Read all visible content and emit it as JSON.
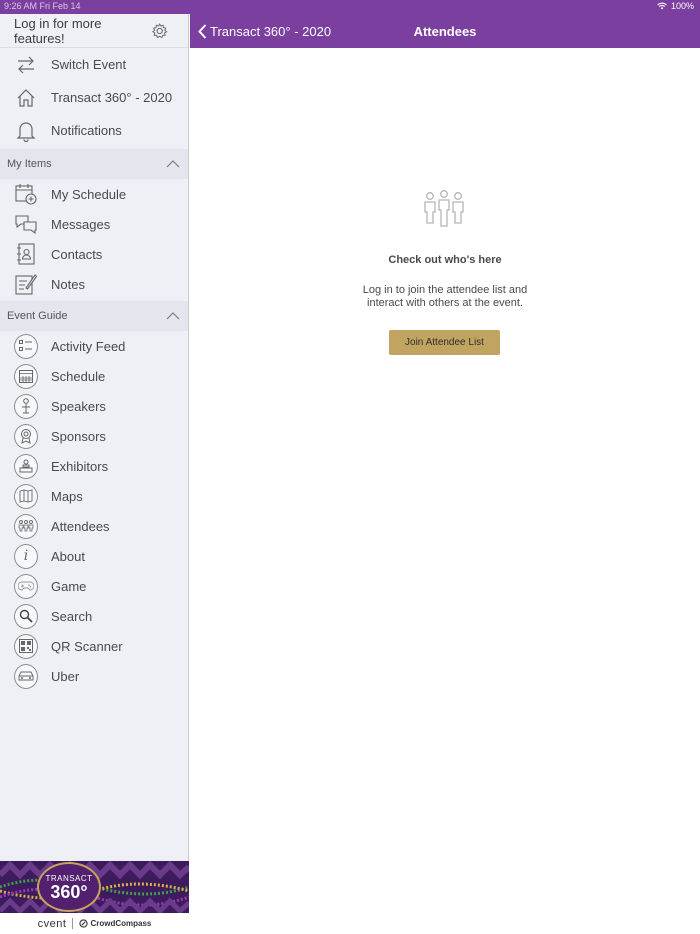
{
  "status_bar": {
    "time_date": "9:26 AM   Fri Feb 14",
    "battery": "100%"
  },
  "sidebar": {
    "login_prompt": "Log in for more features!",
    "top_items": [
      {
        "label": "Switch Event",
        "icon": "switch-arrows-icon"
      },
      {
        "label": "Transact 360° - 2020",
        "icon": "home-icon"
      },
      {
        "label": "Notifications",
        "icon": "bell-icon"
      }
    ],
    "my_items": {
      "header": "My Items",
      "items": [
        {
          "label": "My Schedule",
          "icon": "calendar-add-icon"
        },
        {
          "label": "Messages",
          "icon": "chat-bubbles-icon"
        },
        {
          "label": "Contacts",
          "icon": "contact-book-icon"
        },
        {
          "label": "Notes",
          "icon": "note-pencil-icon"
        }
      ]
    },
    "event_guide": {
      "header": "Event Guide",
      "items": [
        {
          "label": "Activity Feed",
          "icon": "activity-feed-icon"
        },
        {
          "label": "Schedule",
          "icon": "calendar-icon"
        },
        {
          "label": "Speakers",
          "icon": "speaker-icon"
        },
        {
          "label": "Sponsors",
          "icon": "ribbon-icon"
        },
        {
          "label": "Exhibitors",
          "icon": "exhibitor-icon"
        },
        {
          "label": "Maps",
          "icon": "map-icon"
        },
        {
          "label": "Attendees",
          "icon": "people-icon"
        },
        {
          "label": "About",
          "icon": "info-icon"
        },
        {
          "label": "Game",
          "icon": "game-icon"
        },
        {
          "label": "Search",
          "icon": "search-icon"
        },
        {
          "label": "QR Scanner",
          "icon": "qr-code-icon"
        },
        {
          "label": "Uber",
          "icon": "car-icon"
        }
      ]
    },
    "banner": {
      "logo_line1": "TRANSACT",
      "logo_line2": "360°",
      "brand1": "cvent",
      "brand2": "CrowdCompass"
    }
  },
  "navbar": {
    "back_label": "Transact 360° - 2020",
    "title": "Attendees"
  },
  "empty_state": {
    "icon": "people-icon",
    "title": "Check out who's here",
    "description": "Log in to join the attendee list and interact with others at the event.",
    "button": "Join Attendee List"
  },
  "colors": {
    "brand_purple": "#7b3fa0",
    "button_gold": "#c2a461",
    "sidebar_bg": "#eef0f6"
  }
}
